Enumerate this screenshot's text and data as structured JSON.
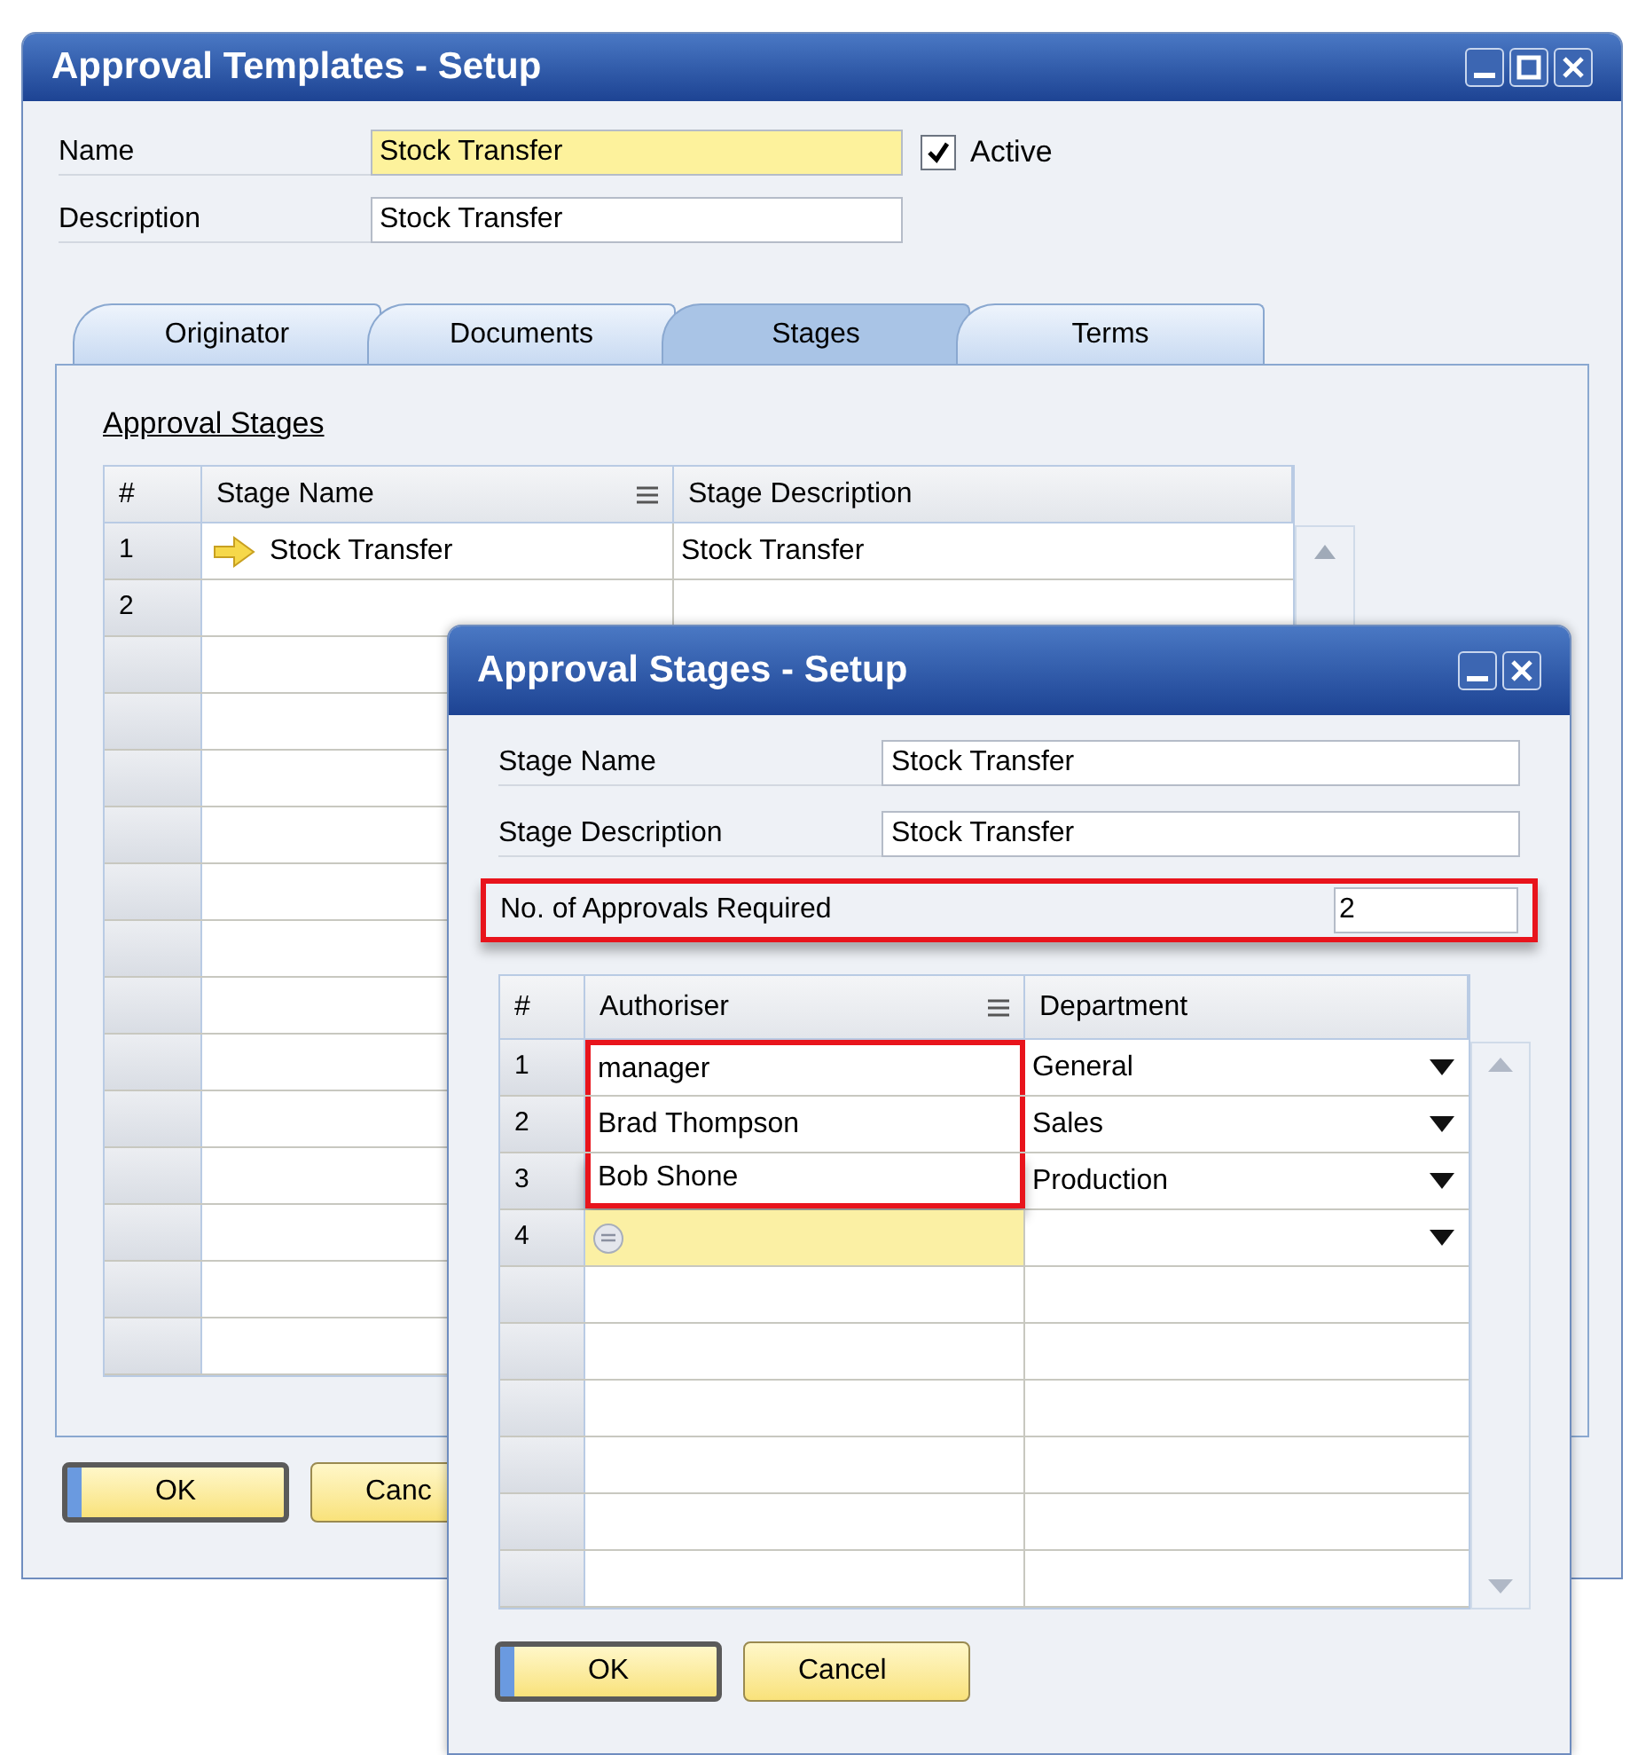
{
  "main_window": {
    "title": "Approval Templates - Setup",
    "fields": [
      {
        "label": "Name",
        "value": "Stock Transfer",
        "highlighted": true
      },
      {
        "label": "Description",
        "value": "Stock Transfer",
        "highlighted": false
      }
    ],
    "active": {
      "label": "Active",
      "checked": true
    },
    "tabs": [
      {
        "label": "Originator",
        "selected": false
      },
      {
        "label": "Documents",
        "selected": false
      },
      {
        "label": "Stages",
        "selected": true
      },
      {
        "label": "Terms",
        "selected": false
      }
    ],
    "section_title": "Approval Stages",
    "table": {
      "columns": [
        "#",
        "Stage Name",
        "Stage Description"
      ],
      "rows": [
        {
          "number": "1",
          "stage_name": "Stock Transfer",
          "stage_description": "Stock Transfer",
          "current": true
        },
        {
          "number": "2",
          "current": false
        }
      ]
    },
    "buttons": [
      {
        "label": "OK",
        "default": true
      },
      {
        "label": "Canc",
        "default": false
      }
    ]
  },
  "dialog": {
    "title": "Approval Stages - Setup",
    "fields": [
      {
        "label": "Stage Name",
        "value": "Stock Transfer"
      },
      {
        "label": "Stage Description",
        "value": "Stock Transfer"
      }
    ],
    "approvals": {
      "label": "No. of Approvals Required",
      "value": "2",
      "annotated": true
    },
    "table": {
      "columns": [
        "#",
        "Authoriser",
        "Department"
      ],
      "authorisers_annotated": true,
      "rows": [
        {
          "number": "1",
          "authoriser": "manager",
          "department": "General",
          "selected": false
        },
        {
          "number": "2",
          "authoriser": "Brad Thompson",
          "department": "Sales",
          "selected": false
        },
        {
          "number": "3",
          "authoriser": "Bob Shone",
          "department": "Production",
          "selected": false
        },
        {
          "number": "4",
          "selected": true
        }
      ]
    },
    "buttons": [
      {
        "label": "OK",
        "default": true
      },
      {
        "label": "Cancel",
        "default": false
      }
    ]
  }
}
